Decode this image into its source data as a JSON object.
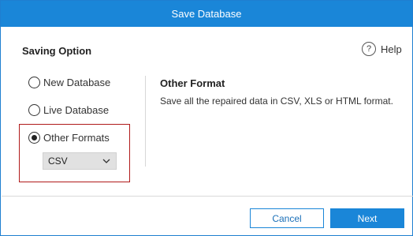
{
  "window": {
    "title": "Save Database"
  },
  "saving_option": {
    "title": "Saving Option",
    "help_label": "Help",
    "options": [
      {
        "label": "New Database",
        "checked": false
      },
      {
        "label": "Live Database",
        "checked": false
      },
      {
        "label": "Other Formats",
        "checked": true
      }
    ],
    "format_select": {
      "value": "CSV"
    }
  },
  "detail": {
    "title": "Other Format",
    "description": "Save all the repaired data in CSV, XLS or HTML format."
  },
  "footer": {
    "cancel_label": "Cancel",
    "next_label": "Next"
  },
  "colors": {
    "accent": "#1a86d8",
    "highlight": "#b01a1a"
  }
}
